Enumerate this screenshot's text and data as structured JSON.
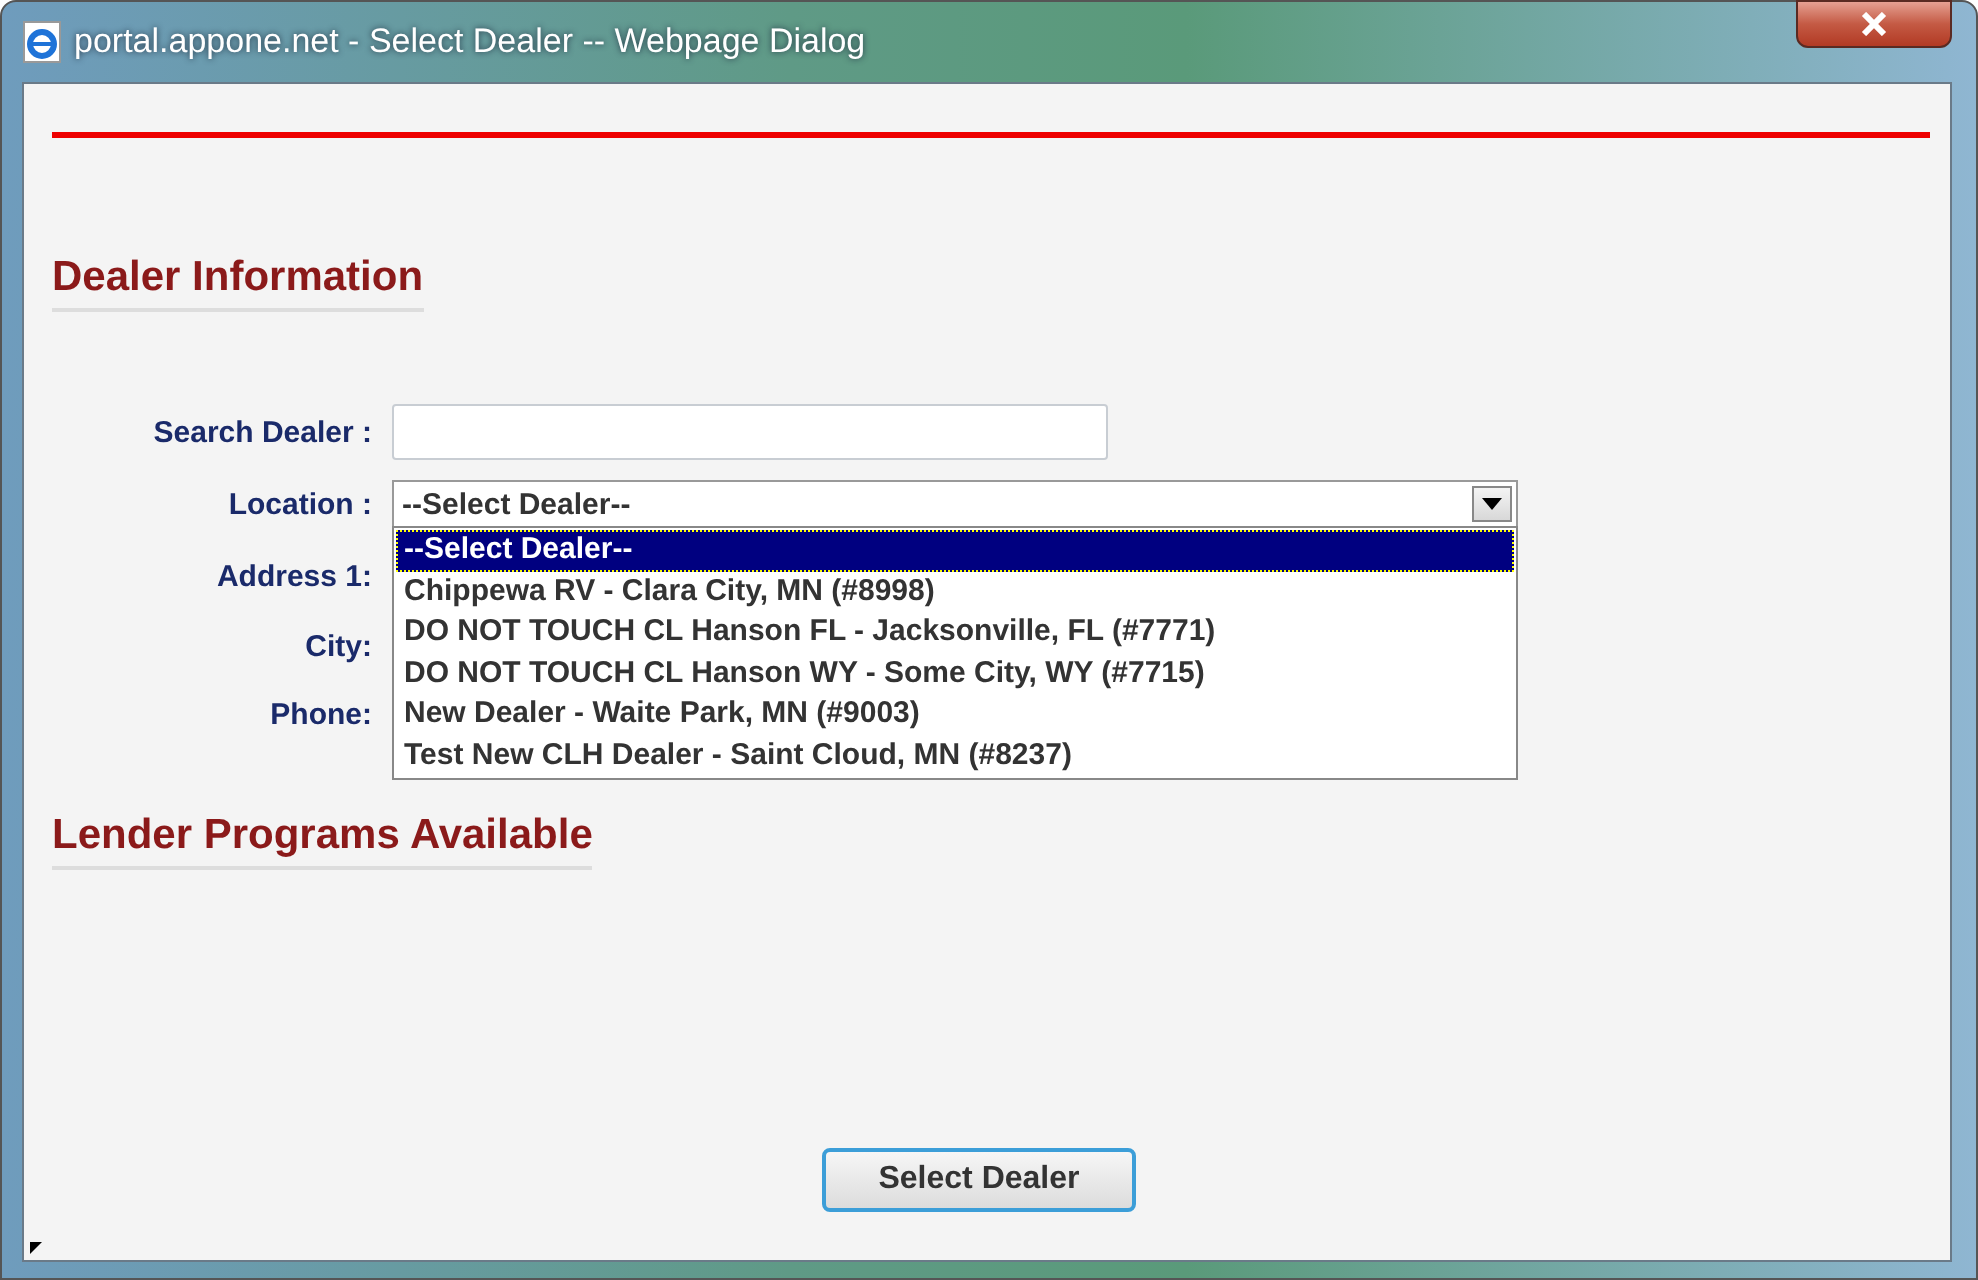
{
  "window": {
    "title": "portal.appone.net - Select Dealer -- Webpage Dialog"
  },
  "sections": [
    {
      "heading": "Dealer Information"
    },
    {
      "heading": "Lender Programs Available"
    }
  ],
  "search": {
    "label": "Search Dealer :"
  },
  "location": {
    "label": "Location :",
    "value": "--Select Dealer--",
    "expanded": true,
    "options": [
      {
        "label": "--Select Dealer--",
        "selected": true
      },
      {
        "label": "Chippewa RV - Clara City, MN (#8998)",
        "selected": false
      },
      {
        "label": "DO NOT TOUCH CL Hanson FL - Jacksonville, FL (#7771)",
        "selected": false
      },
      {
        "label": "DO NOT TOUCH CL Hanson WY - Some City, WY (#7715)",
        "selected": false
      },
      {
        "label": "New Dealer - Waite Park, MN (#9003)",
        "selected": false
      },
      {
        "label": "Test New CLH Dealer - Saint Cloud, MN (#8237)",
        "selected": false
      }
    ]
  },
  "fields": [
    {
      "label": "Address 1:"
    },
    {
      "label": "City:"
    },
    {
      "label": "Phone:"
    }
  ],
  "button": "Select Dealer"
}
